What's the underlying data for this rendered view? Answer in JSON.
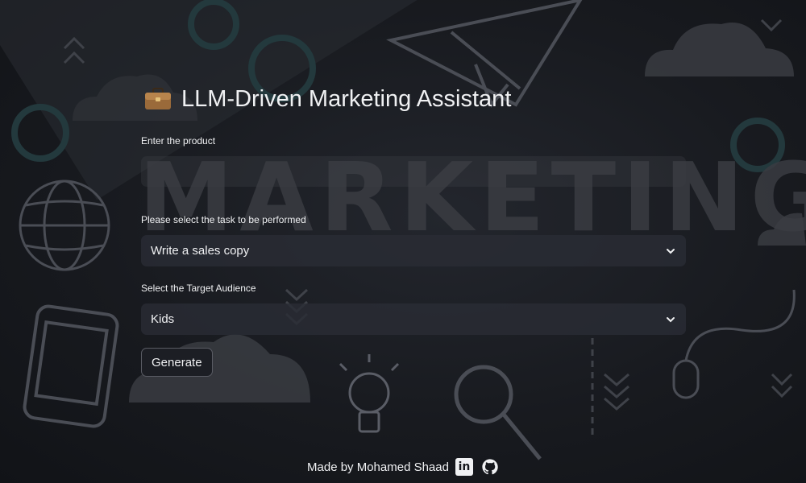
{
  "app": {
    "title": "LLM-Driven Marketing Assistant",
    "background_word": "MARKETING"
  },
  "form": {
    "product_label": "Enter the product",
    "product_value": "",
    "task_label": "Please select the task to be performed",
    "task_selected": "Write a sales copy",
    "audience_label": "Select the Target Audience",
    "audience_selected": "Kids",
    "generate_label": "Generate"
  },
  "footer": {
    "text": "Made by Mohamed Shaad",
    "linkedin_glyph": "in"
  },
  "icons": {
    "title_icon": "briefcase-icon",
    "select_icon": "chevron-down-icon",
    "social": [
      "linkedin-icon",
      "github-icon"
    ]
  },
  "colors": {
    "background": "#15171c",
    "text": "#f0f1f3",
    "input_bg": "#2a2c34",
    "button_border": "#5a5c64"
  }
}
